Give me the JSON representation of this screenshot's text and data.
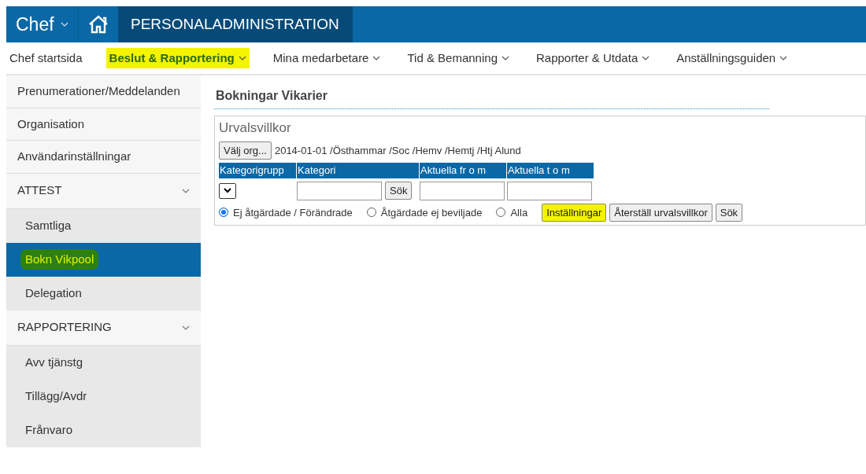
{
  "app_bar": {
    "app_menu": "Chef",
    "title": "PERSONALADMINISTRATION"
  },
  "menu": [
    {
      "label": "Chef startsida",
      "dropdown": false,
      "selected": false,
      "highlighted": false
    },
    {
      "label": "Beslut & Rapportering",
      "dropdown": true,
      "selected": true,
      "highlighted": true
    },
    {
      "label": "Mina medarbetare",
      "dropdown": true,
      "selected": false,
      "highlighted": false
    },
    {
      "label": "Tid & Bemanning",
      "dropdown": true,
      "selected": false,
      "highlighted": false
    },
    {
      "label": "Rapporter & Utdata",
      "dropdown": true,
      "selected": false,
      "highlighted": false
    },
    {
      "label": "Anställningsguiden",
      "dropdown": true,
      "selected": false,
      "highlighted": false
    }
  ],
  "sidebar": {
    "items": [
      {
        "label": "Prenumerationer/Meddelanden",
        "kind": "link"
      },
      {
        "label": "Organisation",
        "kind": "link"
      },
      {
        "label": "Användarinställningar",
        "kind": "link"
      },
      {
        "label": "ATTEST",
        "kind": "section",
        "expanded": true,
        "children": [
          {
            "label": "Samtliga",
            "selected": false,
            "highlighted": false
          },
          {
            "label": "Bokn Vikpool",
            "selected": true,
            "highlighted": true
          },
          {
            "label": "Delegation",
            "selected": false,
            "highlighted": false
          }
        ]
      },
      {
        "label": "RAPPORTERING",
        "kind": "section",
        "expanded": true,
        "children": [
          {
            "label": "Avv tjänstg",
            "selected": false,
            "highlighted": false
          },
          {
            "label": "Tillägg/Avdr",
            "selected": false,
            "highlighted": false
          },
          {
            "label": "Frånvaro",
            "selected": false,
            "highlighted": false
          }
        ]
      }
    ]
  },
  "page": {
    "title": "Bokningar Vikarier",
    "filter": {
      "legend": "Urvalsvillkor",
      "org_button": "Välj org...",
      "org_path": "2014-01-01 /Östhammar /Soc /Hemv /Hemtj /Htj Alund",
      "columns": [
        "Kategorigrupp",
        "Kategori",
        "Aktuella fr o m",
        "Aktuella t o m"
      ],
      "category_search_button": "Sök",
      "radios": [
        {
          "label": "Ej åtgärdade / Förändrade",
          "selected": true
        },
        {
          "label": "Åtgärdade ej beviljade",
          "selected": false
        },
        {
          "label": "Alla",
          "selected": false
        }
      ],
      "buttons": [
        {
          "label": "Inställningar",
          "highlighted": true
        },
        {
          "label": "Återställ urvalsvillkor",
          "highlighted": false
        },
        {
          "label": "Sök",
          "highlighted": false
        }
      ]
    }
  }
}
